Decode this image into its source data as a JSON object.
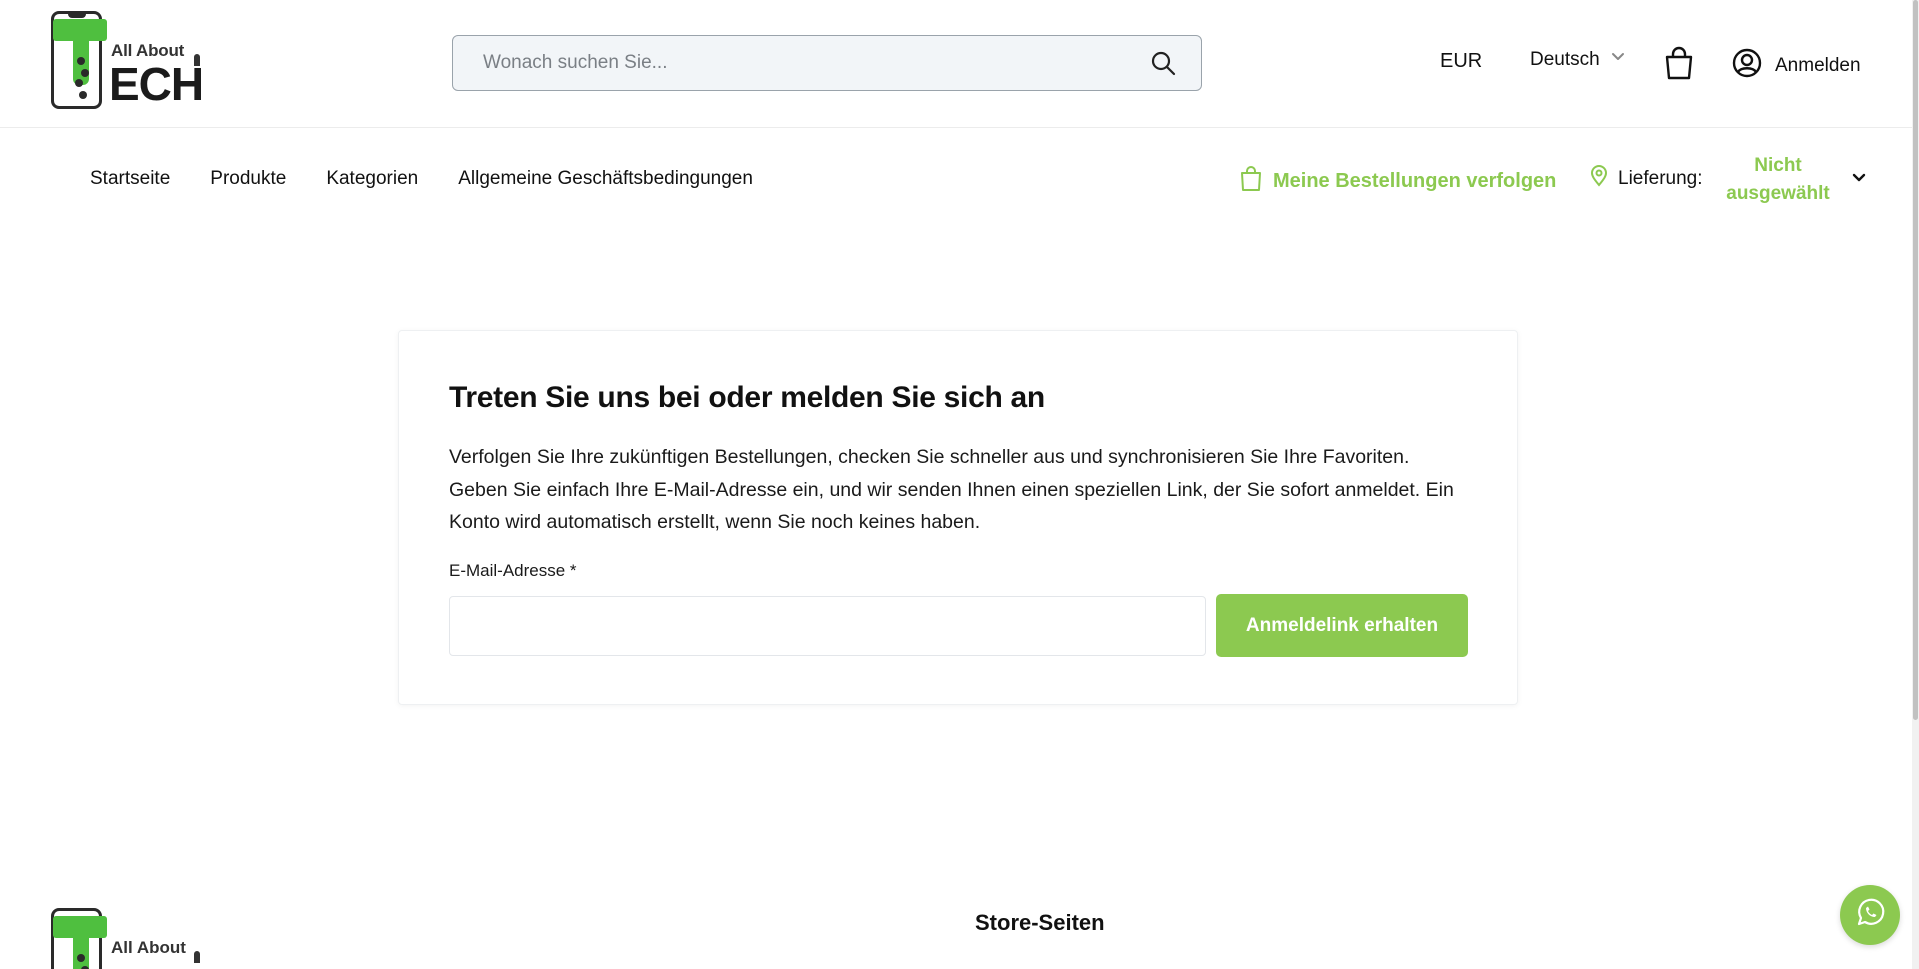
{
  "logo": {
    "top_text": "All About",
    "main_text": "ECH"
  },
  "search": {
    "placeholder": "Wonach suchen Sie..."
  },
  "header": {
    "currency": "EUR",
    "language": "Deutsch",
    "login_label": "Anmelden"
  },
  "nav": {
    "items": [
      {
        "label": "Startseite"
      },
      {
        "label": "Produkte"
      },
      {
        "label": "Kategorien"
      },
      {
        "label": "Allgemeine Geschäftsbedingungen"
      }
    ],
    "track_orders": "Meine Bestellungen verfolgen",
    "delivery_label": "Lieferung:",
    "delivery_value": "Nicht ausgewählt"
  },
  "login_card": {
    "title": "Treten Sie uns bei oder melden Sie sich an",
    "description": "Verfolgen Sie Ihre zukünftigen Bestellungen, checken Sie schneller aus und synchronisieren Sie Ihre Favoriten. Geben Sie einfach Ihre E-Mail-Adresse ein, und wir senden Ihnen einen speziellen Link, der Sie sofort anmeldet. Ein Konto wird automatisch erstellt, wenn Sie noch keines haben.",
    "email_label": "E-Mail-Adresse *",
    "email_value": "",
    "submit_label": "Anmeldelink erhalten"
  },
  "footer": {
    "logo_top_text": "All About",
    "store_pages_heading": "Store-Seiten"
  },
  "colors": {
    "accent": "#8cc950",
    "logo_green": "#4fbf3f",
    "text": "#111111"
  },
  "icons": {
    "search": "search-icon",
    "language_chevron": "chevron-down-icon",
    "cart": "shopping-bag-icon",
    "account": "user-circle-icon",
    "track": "shopping-bag-icon",
    "delivery": "location-pin-icon",
    "delivery_chevron": "chevron-down-icon",
    "whatsapp": "whatsapp-icon"
  }
}
